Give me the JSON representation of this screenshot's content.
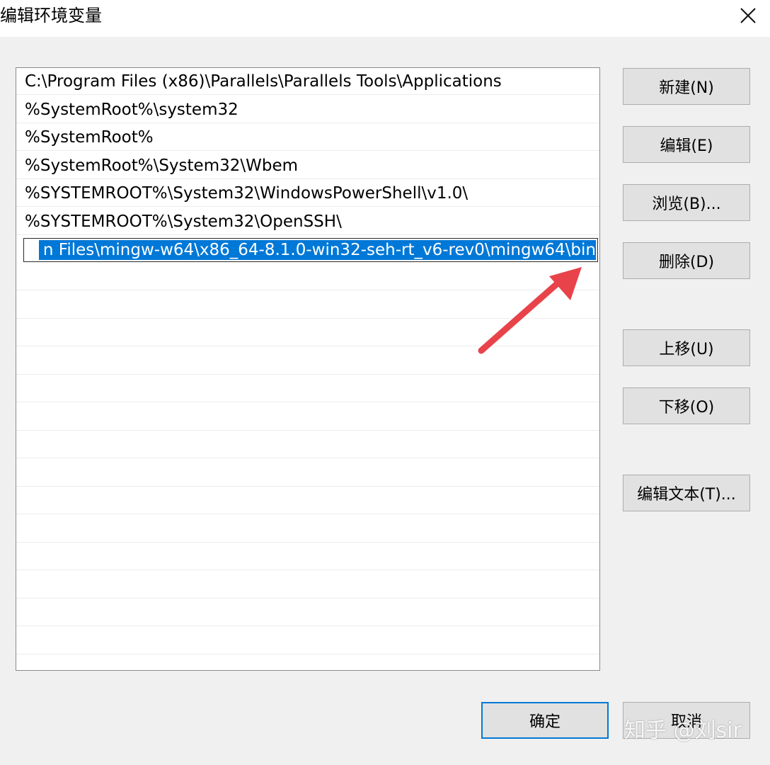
{
  "window": {
    "title": "编辑环境变量",
    "close_icon": "close-icon"
  },
  "path_list": {
    "items": [
      "C:\\Program Files (x86)\\Parallels\\Parallels Tools\\Applications",
      "%SystemRoot%\\system32",
      "%SystemRoot%",
      "%SystemRoot%\\System32\\Wbem",
      "%SYSTEMROOT%\\System32\\WindowsPowerShell\\v1.0\\",
      "%SYSTEMROOT%\\System32\\OpenSSH\\"
    ],
    "editing_value": "n Files\\mingw-w64\\x86_64-8.1.0-win32-seh-rt_v6-rev0\\mingw64\\bin"
  },
  "buttons": {
    "new": "新建(N)",
    "edit": "编辑(E)",
    "browse": "浏览(B)...",
    "delete": "删除(D)",
    "move_up": "上移(U)",
    "move_down": "下移(O)",
    "edit_text": "编辑文本(T)...",
    "ok": "确定",
    "cancel": "取消"
  },
  "annotation": {
    "arrow_color": "#e8434a"
  },
  "watermark": "知乎 @刘sir",
  "colors": {
    "selection": "#0078d7",
    "default_button_border": "#0078d7"
  }
}
